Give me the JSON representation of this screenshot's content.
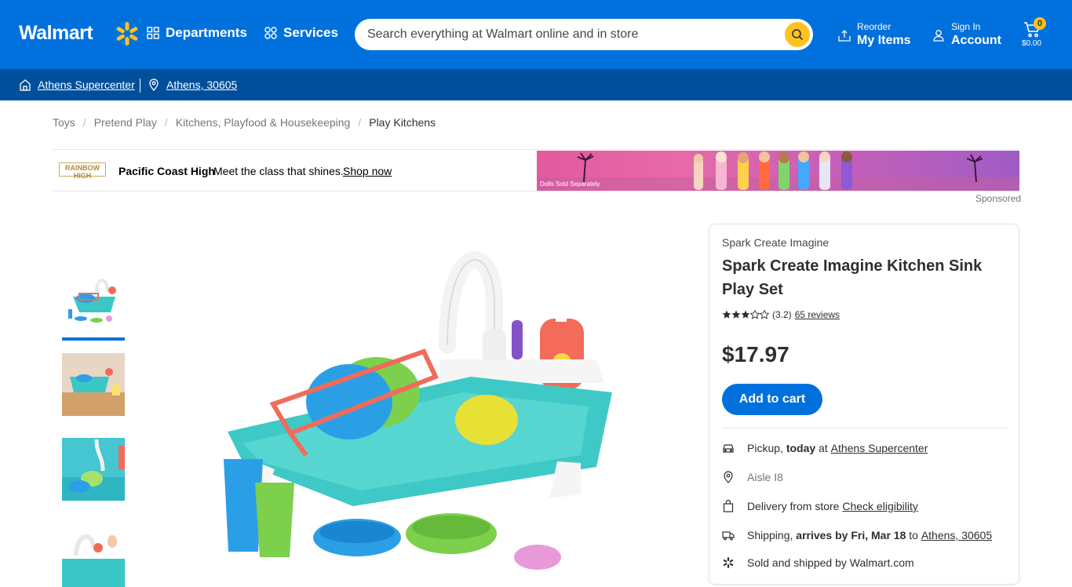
{
  "header": {
    "logo_text": "Walmart",
    "departments_label": "Departments",
    "services_label": "Services",
    "search_placeholder": "Search everything at Walmart online and in store",
    "reorder_small": "Reorder",
    "reorder_big": "My Items",
    "signin_small": "Sign In",
    "signin_big": "Account",
    "cart_count": "0",
    "cart_total": "$0.00"
  },
  "subheader": {
    "store_name": "Athens Supercenter",
    "location": "Athens, 30605"
  },
  "breadcrumb": [
    "Toys",
    "Pretend Play",
    "Kitchens, Playfood & Housekeeping",
    "Play Kitchens"
  ],
  "ad": {
    "logo_text": "RAINBOW HIGH",
    "brand": "Pacific Coast High",
    "text": "Meet the class that shines.",
    "link": "Shop now",
    "disclaimer": "Dolls Sold Separately",
    "sponsored": "Sponsored"
  },
  "thumbnails_selected_index": 0,
  "product": {
    "brand": "Spark Create Imagine",
    "title": "Spark Create Imagine Kitchen Sink Play Set",
    "rating_value": 3.2,
    "rating_text": "(3.2)",
    "reviews": "65 reviews",
    "price": "$17.97",
    "add_to_cart": "Add to cart"
  },
  "fulfillment": {
    "pickup_prefix": "Pickup,",
    "pickup_when": "today",
    "pickup_at": "at",
    "pickup_store": "Athens Supercenter",
    "aisle": "Aisle I8",
    "delivery_prefix": "Delivery from store",
    "delivery_link": "Check eligibility",
    "shipping_prefix": "Shipping,",
    "shipping_when": "arrives by Fri, Mar 18",
    "shipping_to": "to",
    "shipping_location": "Athens, 30605",
    "sold_by": "Sold and shipped by Walmart.com"
  },
  "colors": {
    "brand_blue": "#0071dc",
    "dark_blue": "#004f9a",
    "accent_yellow": "#ffc220"
  }
}
